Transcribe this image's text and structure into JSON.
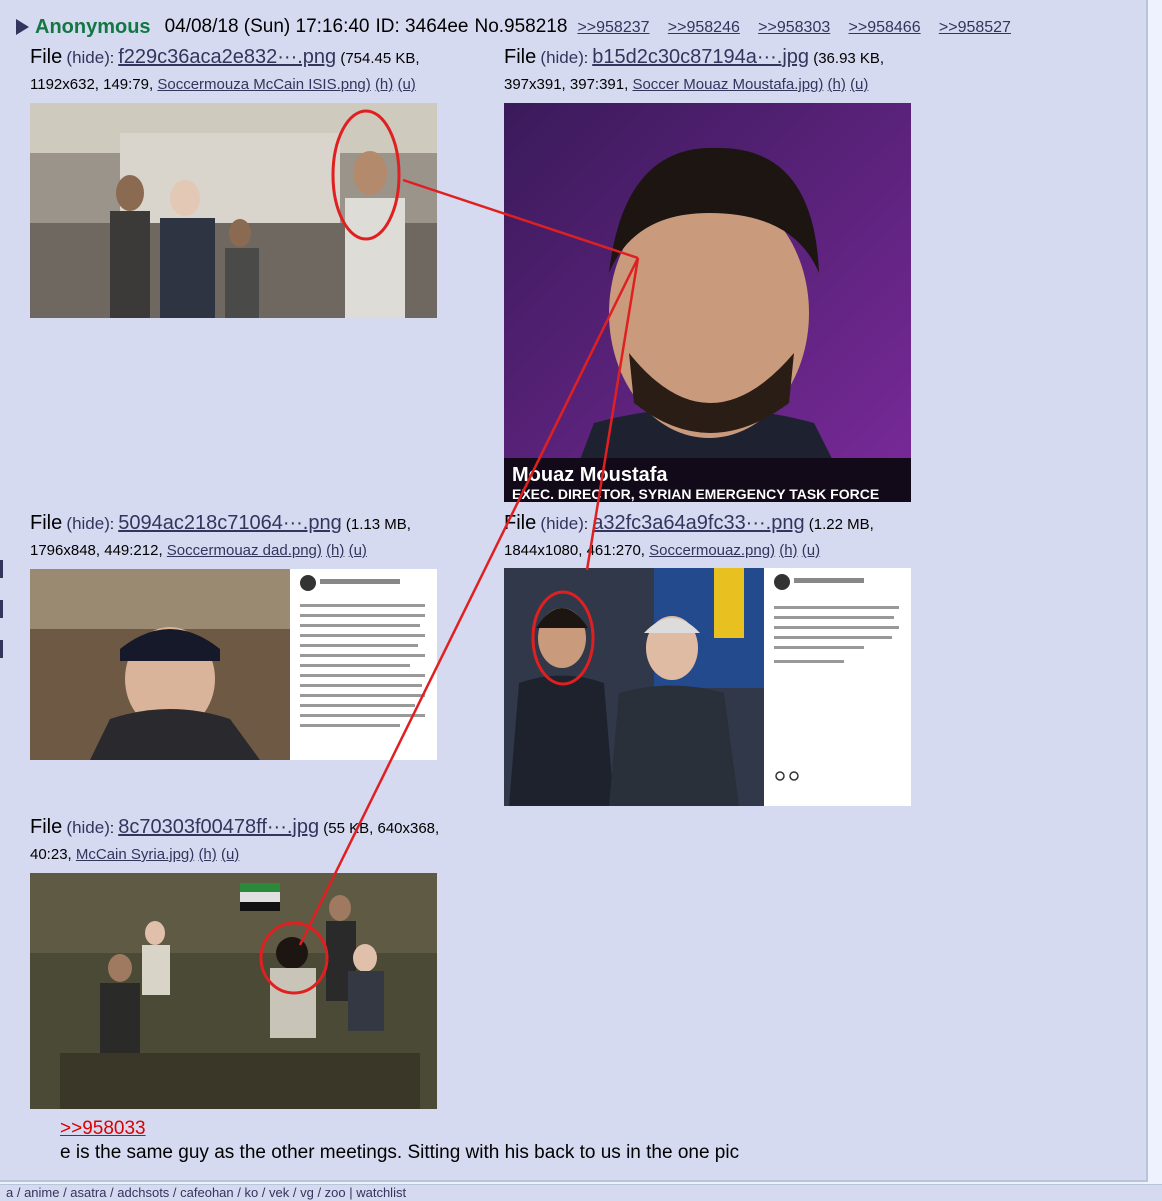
{
  "post": {
    "name": "Anonymous",
    "date": "04/08/18 (Sun) 17:16:40",
    "id": "ID: 3464ee",
    "number": "No.958218",
    "backlinks": [
      ">>958237",
      ">>958246",
      ">>958303",
      ">>958466",
      ">>958527"
    ],
    "quote": ">>958033",
    "comment": "e is the same guy as the other meetings. Sitting with his back to us in the one pic"
  },
  "labels": {
    "file": "File",
    "hide": "(hide)",
    "h": "(h)",
    "u": "(u)"
  },
  "files": [
    {
      "filename": "f229c36aca2e832···.png",
      "size": "(754.45 KB,",
      "meta": "1192x632, 149:79,",
      "original": "Soccermouza McCain ISIS.png)"
    },
    {
      "filename": "b15d2c30c87194a···.jpg",
      "size": "(36.93 KB,",
      "meta": "397x391, 397:391,",
      "original": "Soccer Mouaz Moustafa.jpg)"
    },
    {
      "filename": "5094ac218c71064···.png",
      "size": "(1.13 MB,",
      "meta": "1796x848, 449:212,",
      "original": "Soccermouaz dad.png)"
    },
    {
      "filename": "a32fc3a64a9fc33···.png",
      "size": "(1.22 MB,",
      "meta": "1844x1080, 461:270,",
      "original": "Soccermouaz.png)"
    },
    {
      "filename": "8c70303f00478ff···.jpg",
      "size": "(55 KB, 640x368,",
      "meta": "40:23,",
      "original": "McCain Syria.jpg)"
    }
  ],
  "image_text": {
    "caption_name": "Mouaz Moustafa",
    "caption_title": "EXEC. DIRECTOR, SYRIAN EMERGENCY TASK FORCE"
  },
  "boardbar": "a / anime / asatra / adchsots / cafeohan / ko / vek / vg / zoo  |  watchlist",
  "colors": {
    "accent": "#117743",
    "link": "#34345c",
    "quote": "#dd0000",
    "annotation": "#e02020"
  }
}
